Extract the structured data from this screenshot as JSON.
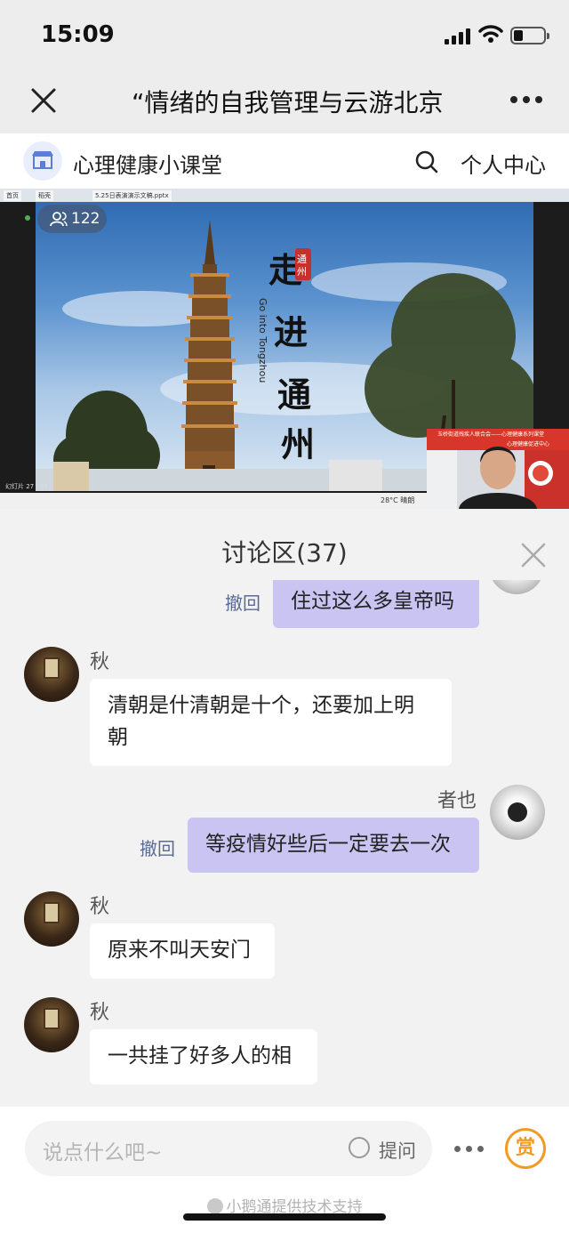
{
  "status_bar": {
    "time": "15:09"
  },
  "nav": {
    "title": "“情绪的自我管理与云游北京"
  },
  "shop": {
    "name": "心理健康小课堂",
    "center_label": "个人中心"
  },
  "video": {
    "viewer_count": "122",
    "browser_tabs": [
      "首页",
      "稻壳",
      "5.25日表演演示文稿.pptx"
    ],
    "slide_page": "幻灯片 27 / 37",
    "slide_title": "走进通州",
    "slide_seal": "通州",
    "slide_subtitle": "Go into Tongzhou",
    "weather": "28°C  晴朗",
    "cam_banner_line1": "玉桥街道残疾人联合会——心理健康系列课堂",
    "cam_banner_line2": "心理健康促进中心"
  },
  "discussion": {
    "title": "讨论区(37)",
    "recall_label": "撤回",
    "messages": [
      {
        "from": "self",
        "text": "住过这么多皇帝吗"
      },
      {
        "from": "秋",
        "text_line1": "清朝是什清朝是十个，还要加上明",
        "text_line2": "朝"
      },
      {
        "from": "者也",
        "text": "等疫情好些后一定要去一次"
      },
      {
        "from": "秋",
        "text": "原来不叫天安门"
      },
      {
        "from": "秋",
        "text": "一共挂了好多人的相"
      }
    ]
  },
  "bottom": {
    "input_placeholder": "说点什么吧~",
    "ask_label": "提问",
    "reward_label": "赏",
    "support_text": "小鹅通提供技术支持"
  },
  "colors": {
    "accent": "#c9c4f2",
    "reward": "#f39a25",
    "recall": "#5a6b94"
  }
}
